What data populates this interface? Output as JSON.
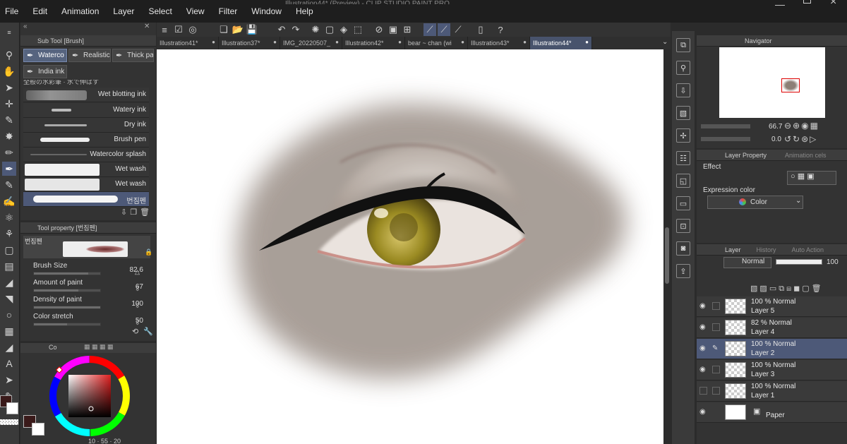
{
  "app": {
    "window_title": "Illustration44* (Preview) - CLIP STUDIO PAINT PRO",
    "menu": [
      "File",
      "Edit",
      "Animation",
      "Layer",
      "Select",
      "View",
      "Filter",
      "Window",
      "Help"
    ]
  },
  "subtool": {
    "header": "Sub Tool [Brush]",
    "tabs": [
      "Waterco",
      "Realistic",
      "Thick pa",
      "India ink"
    ],
    "brushes": [
      {
        "label": "Wet blotting ink"
      },
      {
        "label": "Watery ink"
      },
      {
        "label": "Dry ink"
      },
      {
        "label": "Brush pen"
      },
      {
        "label": "Watercolor splash"
      },
      {
        "label": "Wet wash"
      },
      {
        "label": "Wet wash"
      },
      {
        "label": "번짐펜"
      }
    ],
    "partial_label": "全般の水彩筆 · 水で伸ばす"
  },
  "toolprop": {
    "header": "Tool property [번짐펜]",
    "brush_name": "번짐펜",
    "rows": [
      {
        "label": "Brush Size",
        "value": "82.6",
        "level": 0.82
      },
      {
        "label": "Amount of paint",
        "value": "67",
        "level": 0.67
      },
      {
        "label": "Density of paint",
        "value": "100",
        "level": 1.0
      },
      {
        "label": "Color stretch",
        "value": "50",
        "level": 0.5
      }
    ]
  },
  "colorpanel": {
    "tab": "Co",
    "main_color": "#3a1a1a",
    "sub_color": "#ffffff",
    "readout": "10 · 55 · 20"
  },
  "doctabs": [
    {
      "label": "Illustration41*",
      "active": false
    },
    {
      "label": "Illustration37*",
      "active": false
    },
    {
      "label": "IMG_20220507_",
      "active": false
    },
    {
      "label": "Illustration42*",
      "active": false
    },
    {
      "label": "bear ~ chan (wi",
      "active": false
    },
    {
      "label": "Illustration43*",
      "active": false
    },
    {
      "label": "Illustration44*",
      "active": true
    }
  ],
  "navigator": {
    "tab": "Navigator",
    "zoom": "66.7",
    "rotate": "0.0"
  },
  "layerprop": {
    "tab1": "Layer Property",
    "tab2": "Animation cels",
    "effect_label": "Effect",
    "expression_label": "Expression color",
    "expression_value": "Color"
  },
  "layerpanel": {
    "tab1": "Layer",
    "tab2": "History",
    "tab3": "Auto Action",
    "blend": "Normal",
    "opacity": "100",
    "layers": [
      {
        "top": "100 % Normal",
        "name": "Layer 5",
        "visible": true,
        "selected": false
      },
      {
        "top": "82 % Normal",
        "name": "Layer 4",
        "visible": true,
        "selected": false
      },
      {
        "top": "100 % Normal",
        "name": "Layer 2",
        "visible": true,
        "selected": true
      },
      {
        "top": "100 % Normal",
        "name": "Layer 3",
        "visible": true,
        "selected": false
      },
      {
        "top": "100 % Normal",
        "name": "Layer 1",
        "visible": false,
        "selected": false
      },
      {
        "top": "",
        "name": "Paper",
        "visible": true,
        "selected": false
      }
    ]
  },
  "status": {
    "zoom": "66.7",
    "angle": "0.0"
  },
  "colors": {
    "accent_selected": "#4d5978",
    "iris": "#8a7a1e",
    "shadow": "#8c7f76",
    "eyeliner": "#111111"
  }
}
